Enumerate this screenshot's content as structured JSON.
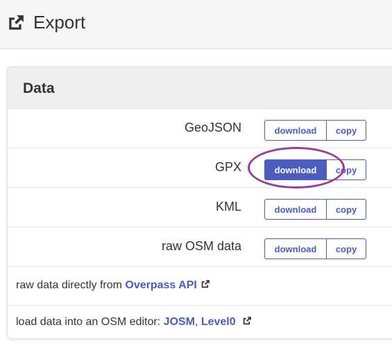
{
  "header": {
    "title": "Export",
    "icon": "external-link-icon"
  },
  "card": {
    "title": "Data"
  },
  "formats": [
    {
      "label": "GeoJSON",
      "download_label": "download",
      "copy_label": "copy",
      "download_active": false
    },
    {
      "label": "GPX",
      "download_label": "download",
      "copy_label": "copy",
      "download_active": true
    },
    {
      "label": "KML",
      "download_label": "download",
      "copy_label": "copy",
      "download_active": false
    },
    {
      "label": "raw OSM data",
      "download_label": "download",
      "copy_label": "copy",
      "download_active": false
    }
  ],
  "links": {
    "raw": {
      "prefix": "raw data directly from ",
      "link_label": "Overpass API"
    },
    "editor": {
      "prefix": "load data into an OSM editor: ",
      "josm_label": "JOSM",
      "separator": ", ",
      "level0_label": "Level0"
    }
  },
  "colors": {
    "accent": "#4c5bc0",
    "highlight": "#9a3c9e"
  }
}
